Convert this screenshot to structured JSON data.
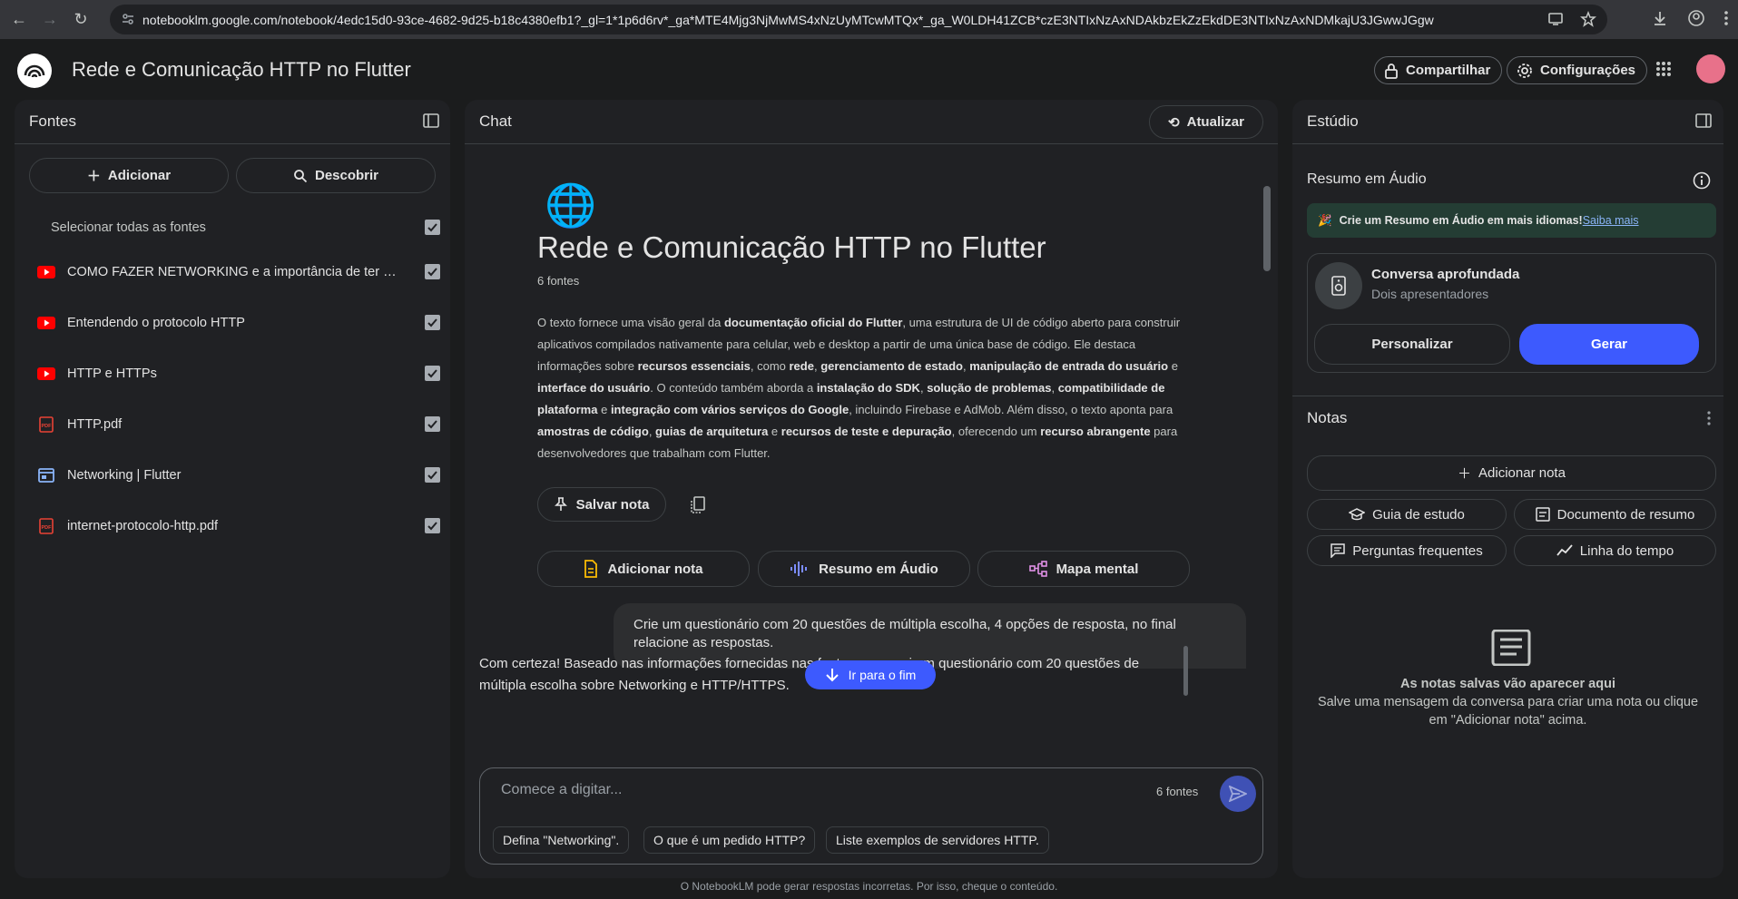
{
  "browser": {
    "url": "notebooklm.google.com/notebook/4edc15d0-93ce-4682-9d25-b18c4380efb1?_gl=1*1p6d6rv*_ga*MTE4Mjg3NjMwMS4xNzUyMTcwMTQx*_ga_W0LDH41ZCB*czE3NTIxNzAxNDAkbzEkZzEkdDE3NTIxNzAxNDMkajU3JGwwJGgw"
  },
  "header": {
    "title": "Rede e Comunicação HTTP no Flutter",
    "share_label": "Compartilhar",
    "settings_label": "Configurações"
  },
  "sources": {
    "title": "Fontes",
    "add_label": "Adicionar",
    "discover_label": "Descobrir",
    "select_all_label": "Selecionar todas as fontes",
    "items": [
      {
        "label": "COMO FAZER NETWORKING e a importância de ter uma rede de contatos",
        "icon": "youtube-icon"
      },
      {
        "label": "Entendendo o protocolo HTTP",
        "icon": "youtube-icon"
      },
      {
        "label": "HTTP e HTTPs",
        "icon": "youtube-icon"
      },
      {
        "label": "HTTP.pdf",
        "icon": "pdf-icon"
      },
      {
        "label": "Networking | Flutter",
        "icon": "web-icon"
      },
      {
        "label": "internet-protocolo-http.pdf",
        "icon": "pdf-icon"
      }
    ]
  },
  "chat": {
    "title": "Chat",
    "refresh_label": "Atualizar",
    "notebook_title": "Rede e Comunicação HTTP no Flutter",
    "source_count": "6 fontes",
    "save_note_label": "Salvar nota",
    "actions": {
      "add_note": "Adicionar nota",
      "audio_summary": "Resumo em Áudio",
      "mind_map": "Mapa mental"
    },
    "user_message": "Crie um questionário com 20 questões de múltipla escolha, 4 opções de resposta, no final relacione as respostas.",
    "ai_message": "Com certeza! Baseado nas informações fornecidas nas fontes, preparei um questionário com 20 questões de múltipla escolha sobre Networking e HTTP/HTTPS.",
    "jump_label": "Ir para o fim",
    "input_placeholder": "Comece a digitar...",
    "input_source_count": "6 fontes",
    "suggestions": [
      "Defina \"Networking\".",
      "O que é um pedido HTTP?",
      "Liste exemplos de servidores HTTP."
    ]
  },
  "studio": {
    "title": "Estúdio",
    "audio_title": "Resumo em Áudio",
    "banner_text": "Crie um Resumo em Áudio em mais idiomas!",
    "banner_link": "Saiba mais",
    "card_title": "Conversa aprofundada",
    "card_subtitle": "Dois apresentadores",
    "customize_label": "Personalizar",
    "generate_label": "Gerar",
    "notes_title": "Notas",
    "add_note_label": "Adicionar nota",
    "study_guide_label": "Guia de estudo",
    "summary_doc_label": "Documento de resumo",
    "faq_label": "Perguntas frequentes",
    "timeline_label": "Linha do tempo",
    "empty_title": "As notas salvas vão aparecer aqui",
    "empty_desc": "Salve uma mensagem da conversa para criar uma nota ou clique em \"Adicionar nota\" acima."
  },
  "footer": "O NotebookLM pode gerar respostas incorretas. Por isso, cheque o conteúdo.",
  "colors": {
    "accent": "#3d5afe",
    "youtube": "#ff0000",
    "pdf": "#e94235",
    "web": "#8ab4f8"
  }
}
